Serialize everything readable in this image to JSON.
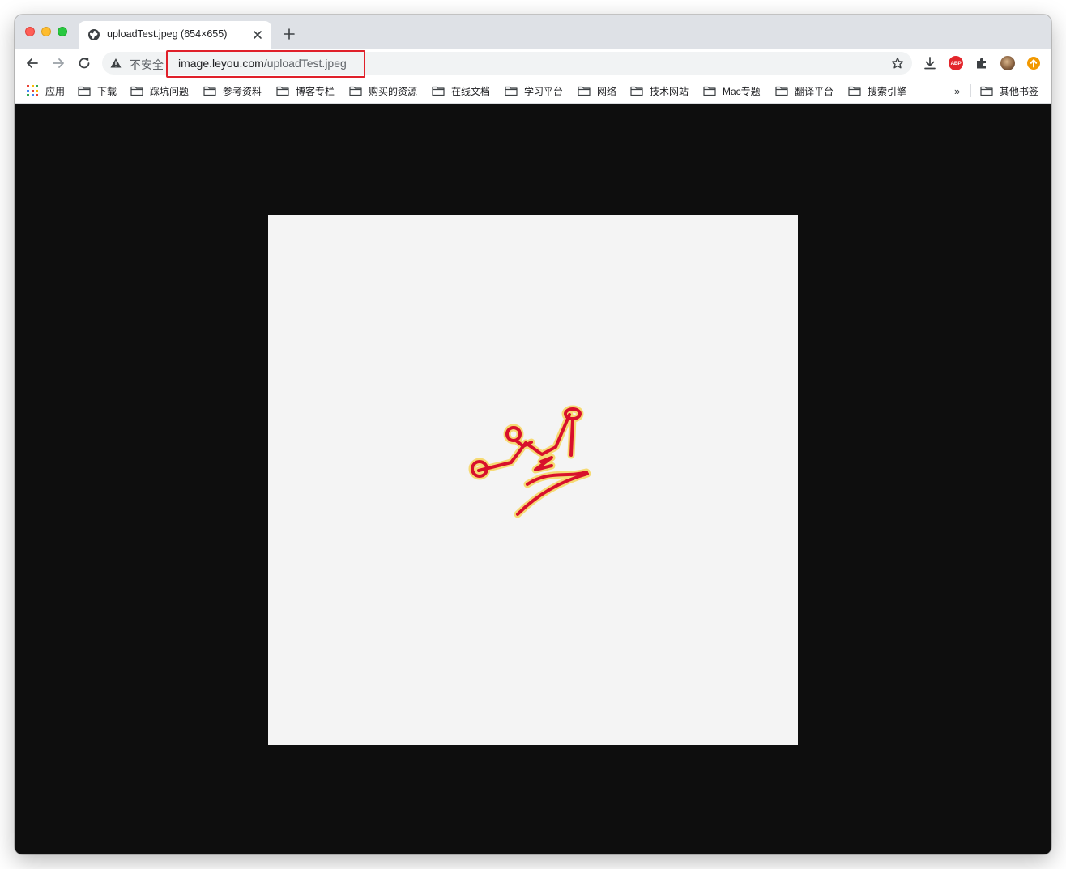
{
  "tab": {
    "title": "uploadTest.jpeg (654×655)"
  },
  "toolbar": {
    "security_label": "不安全",
    "url_host": "image.leyou.com",
    "url_path": "/uploadTest.jpeg",
    "abp_label": "ABP"
  },
  "bookmarks": {
    "apps_label": "应用",
    "items": [
      {
        "label": "下载"
      },
      {
        "label": "踩坑问题"
      },
      {
        "label": "参考资料"
      },
      {
        "label": "博客专栏"
      },
      {
        "label": "购买的资源"
      },
      {
        "label": "在线文档"
      },
      {
        "label": "学习平台"
      },
      {
        "label": "网络"
      },
      {
        "label": "技术网站"
      },
      {
        "label": "Mac专题"
      },
      {
        "label": "翻译平台"
      },
      {
        "label": "搜索引擎"
      }
    ],
    "overflow_label": "»",
    "other_label": "其他书签"
  },
  "colors": {
    "highlight": "#e0202a",
    "crown_stroke": "#d8102c",
    "crown_glow": "#f7d24a",
    "viewer_bg": "#0e0e0e"
  },
  "icons": {
    "back": "arrow-left-icon",
    "forward": "arrow-right-icon",
    "reload": "reload-icon",
    "warning": "warning-triangle-icon",
    "star": "star-icon",
    "download": "download-icon",
    "extensions": "puzzle-icon",
    "folder": "folder-icon"
  }
}
